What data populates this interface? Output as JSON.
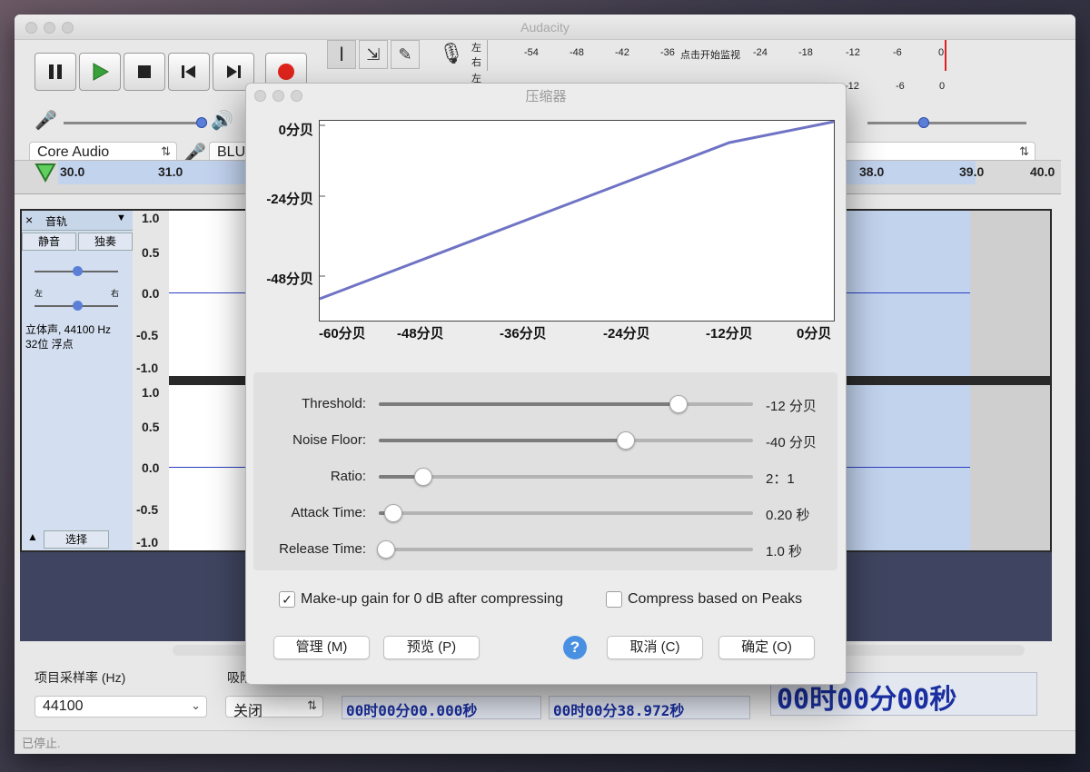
{
  "main": {
    "title": "Audacity",
    "meter": {
      "left": "左",
      "right": "右",
      "ticks": [
        "-54",
        "-48",
        "-42",
        "-36",
        "-24",
        "-18",
        "-12",
        "-6",
        "0"
      ],
      "ticks2": [
        "-12",
        "-6",
        "0"
      ],
      "monitor_text": "点击开始监视"
    },
    "host": "Core Audio",
    "device": "BLU",
    "ruler": [
      "30.0",
      "31.0",
      "38.0",
      "39.0",
      "40.0"
    ],
    "track": {
      "name": "音轨",
      "mute": "静音",
      "solo": "独奏",
      "pan_left": "左",
      "pan_right": "右",
      "info1": "立体声, 44100 Hz",
      "info2": "32位 浮点",
      "select": "选择",
      "scale": [
        "1.0",
        "0.5",
        "0.0",
        "-0.5",
        "-1.0",
        "1.0",
        "0.5",
        "0.0",
        "-0.5",
        "-1.0"
      ]
    },
    "bottom": {
      "rate_label": "项目采样率 (Hz)",
      "rate_value": "44100",
      "snap_label": "吸附",
      "snap_value": "关闭",
      "sel_start": "00时00分00.000秒",
      "sel_end": "00时00分38.972秒",
      "audio_pos": "00时00分00秒"
    },
    "status": "已停止."
  },
  "dialog": {
    "title": "压缩器",
    "graph": {
      "y_labels": [
        "0分贝",
        "-24分贝",
        "-48分贝"
      ],
      "x_labels": [
        "-60分贝",
        "-48分贝",
        "-36分贝",
        "-24分贝",
        "-12分贝",
        "0分贝"
      ],
      "line_color": "#6f73c4"
    },
    "settings": [
      {
        "label": "Threshold:",
        "value": "-12 分贝",
        "level": 0.8
      },
      {
        "label": "Noise Floor:",
        "value": "-40 分贝",
        "level": 0.66
      },
      {
        "label": "Ratio:",
        "value": "2：1",
        "level": 0.12
      },
      {
        "label": "Attack Time:",
        "value": "0.20 秒",
        "level": 0.04
      },
      {
        "label": "Release Time:",
        "value": "1.0 秒",
        "level": 0.02
      }
    ],
    "makeup_gain": {
      "label": "Make-up gain for 0 dB after compressing",
      "checked": true
    },
    "peaks": {
      "label": "Compress based on Peaks",
      "checked": false
    },
    "buttons": {
      "manage": "管理 (M)",
      "preview": "预览 (P)",
      "help": "?",
      "cancel": "取消 (C)",
      "ok": "确定 (O)"
    }
  }
}
